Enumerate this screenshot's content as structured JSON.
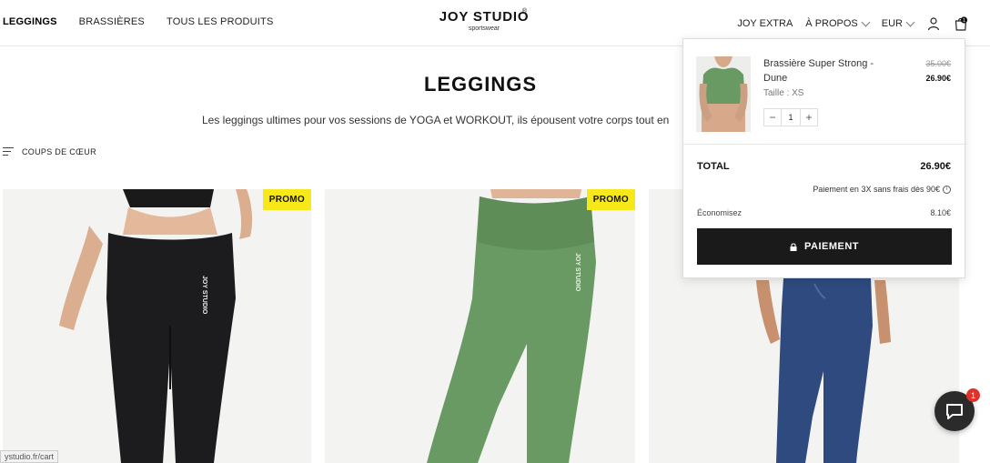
{
  "nav": {
    "left": [
      {
        "label": "LEGGINGS",
        "active": true
      },
      {
        "label": "BRASSIÈRES",
        "active": false
      },
      {
        "label": "TOUS LES PRODUITS",
        "active": false
      }
    ],
    "extra": "JOY EXTRA",
    "about": "À PROPOS",
    "currency": "EUR",
    "cart_count": "1"
  },
  "logo": {
    "name": "JOY STUDIO",
    "sub": "sportswear",
    "mark": "®"
  },
  "page": {
    "title": "LEGGINGS",
    "description": "Les leggings ultimes pour vos sessions de YOGA et WORKOUT, ils épousent votre corps tout en"
  },
  "sort": {
    "label": "COUPS DE CŒUR"
  },
  "products": [
    {
      "promo": "PROMO",
      "color": "#1c1c1e",
      "print": "JOY STUDIO"
    },
    {
      "promo": "PROMO",
      "color": "#6a9a63",
      "print": "JOY STUDIO"
    },
    {
      "promo": "",
      "color": "#2e4a7e",
      "print": ""
    }
  ],
  "cart": {
    "item_name": "Brassière Super Strong - Dune",
    "item_size": "Taille : XS",
    "price_old": "35.00€",
    "price_new": "26.90€",
    "qty_minus": "−",
    "qty_value": "1",
    "qty_plus": "+",
    "total_label": "TOTAL",
    "total_value": "26.90€",
    "installments": "Paiement en 3X sans frais dès 90€",
    "info": "i",
    "save_label": "Économisez",
    "save_value": "8.10€",
    "pay_label": "PAIEMENT"
  },
  "status_link": "ystudio.fr/cart",
  "chat": {
    "badge": "1"
  },
  "colors": {
    "promo": "#f7e81a",
    "pay_button": "#1a1a1a",
    "badge": "#e0322b"
  }
}
